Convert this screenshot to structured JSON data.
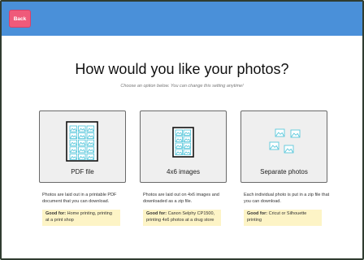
{
  "header": {
    "back_label": "Back",
    "color": "#4a90d9"
  },
  "main": {
    "title": "How would you like your photos?",
    "subtitle": "Choose an option below. You can change this setting anytime!"
  },
  "options": [
    {
      "label": "PDF file",
      "description": "Photos are laid out in a printable PDF document that you can download.",
      "good_for_label": "Good for:",
      "good_for": "Home printing, printing at a print shop",
      "icon": "pdf-sheet-icon"
    },
    {
      "label": "4x6 images",
      "description": "Photos are laid out on 4x6 images and downloaded as a zip file.",
      "good_for_label": "Good for:",
      "good_for": "Canon Selphy CP1500, printing 4x6 photos at a drug store",
      "icon": "4x6-sheet-icon"
    },
    {
      "label": "Separate photos",
      "description": "Each individual photo is put in a zip file that you can download.",
      "good_for_label": "Good for:",
      "good_for": "Cricut or Silhouette printing",
      "icon": "separate-photos-icon"
    }
  ],
  "colors": {
    "accent": "#4a90d9",
    "back_button": "#ef5a7a",
    "photo_icon": "#5bc8dc",
    "good_for_bg": "#fdf4c6"
  }
}
